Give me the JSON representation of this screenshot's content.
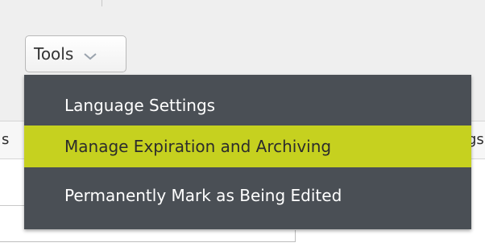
{
  "toolbar": {
    "tools_label": "Tools"
  },
  "tools_menu": {
    "items": [
      {
        "label": "Language Settings",
        "highlighted": false
      },
      {
        "label": "Manage Expiration and Archiving",
        "highlighted": true
      },
      {
        "label": "Permanently Mark as Being Edited",
        "highlighted": false
      }
    ]
  },
  "tab_strip": {
    "left_fragment": "s",
    "right_fragment": "gs"
  },
  "colors": {
    "menu_background": "#4a4f55",
    "highlight": "#c6d11f",
    "menu_text": "#ffffff",
    "highlight_text": "#2c2c2c"
  },
  "icons": {
    "tools_button": "chevron-down-icon"
  }
}
